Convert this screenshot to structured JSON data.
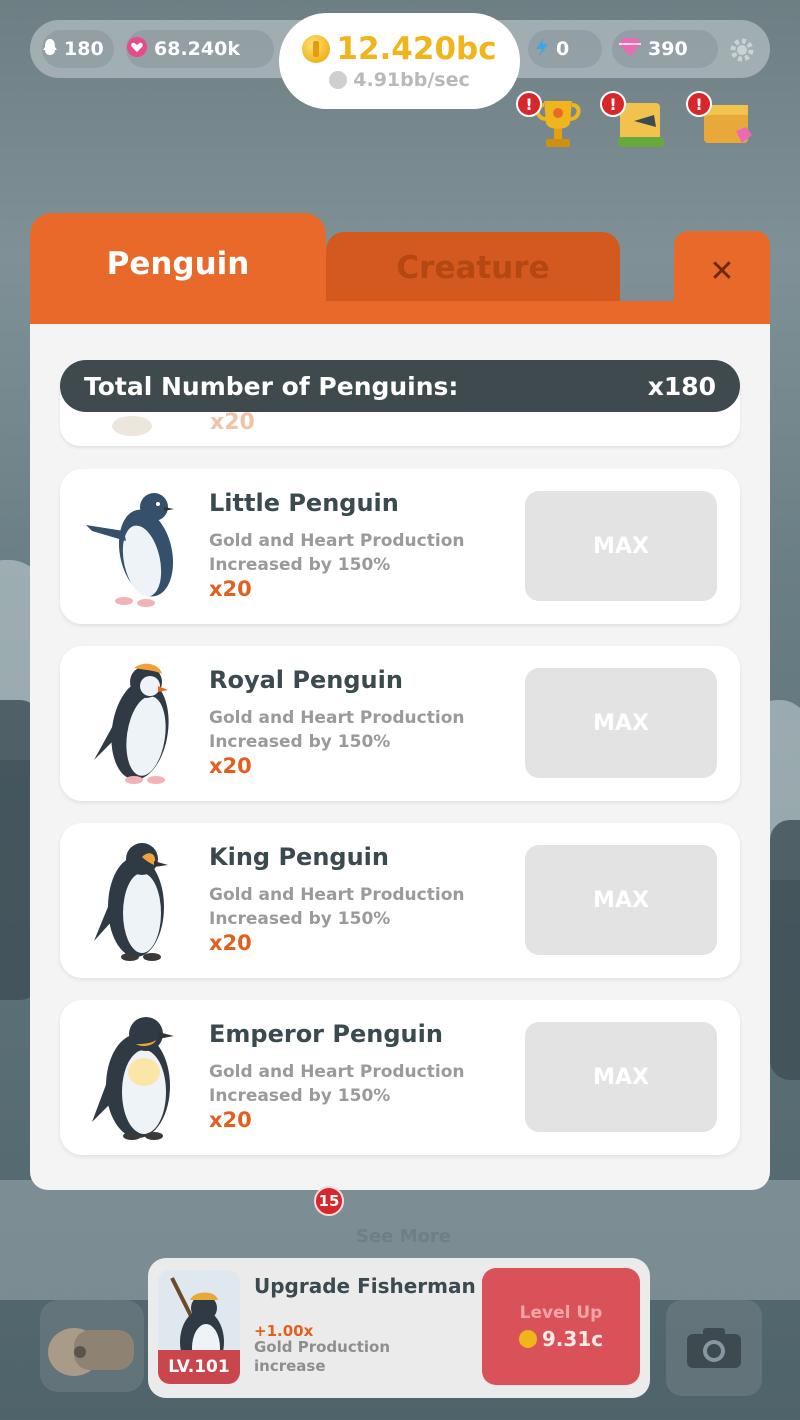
{
  "hud": {
    "penguins": "180",
    "hearts": "68.240k",
    "gold": "12.420bc",
    "gold_rate": "4.91bb/sec",
    "energy": "0",
    "gems": "390"
  },
  "top_icons": [
    {
      "name": "trophy-icon",
      "alert": "!"
    },
    {
      "name": "quest-scroll-icon",
      "alert": "!"
    },
    {
      "name": "shop-box-icon",
      "alert": "!"
    }
  ],
  "modal": {
    "tabs": [
      {
        "label": "Penguin",
        "active": true
      },
      {
        "label": "Creature",
        "active": false
      }
    ],
    "close_label": "✕",
    "total_label": "Total Number of Penguins:",
    "total_value": "x180",
    "partial_mult": "x20",
    "cards": [
      {
        "name": "Little Penguin",
        "desc": "Gold and Heart Production Increased by 150%",
        "mult": "x20",
        "button": "MAX"
      },
      {
        "name": "Royal Penguin",
        "desc": "Gold and Heart Production Increased by 150%",
        "mult": "x20",
        "button": "MAX"
      },
      {
        "name": "King Penguin",
        "desc": "Gold and Heart Production Increased by 150%",
        "mult": "x20",
        "button": "MAX"
      },
      {
        "name": "Emperor Penguin",
        "desc": "Gold and Heart Production Increased by 150%",
        "mult": "x20",
        "button": "MAX"
      }
    ]
  },
  "below": {
    "badge": "15",
    "see_more": "See More"
  },
  "upgrade": {
    "title": "Upgrade Fisherman",
    "level": "LV.101",
    "mult": "+1.00x",
    "desc": "Gold Production increase",
    "button_label": "Level Up",
    "cost": "9.31c"
  },
  "colors": {
    "accent_orange": "#e8692a",
    "tab_inactive": "#d4591f",
    "dark_bar": "#3f4a4f",
    "gold": "#f0b41c",
    "levelup_red": "#d9525a",
    "multiplier": "#e2601f"
  }
}
